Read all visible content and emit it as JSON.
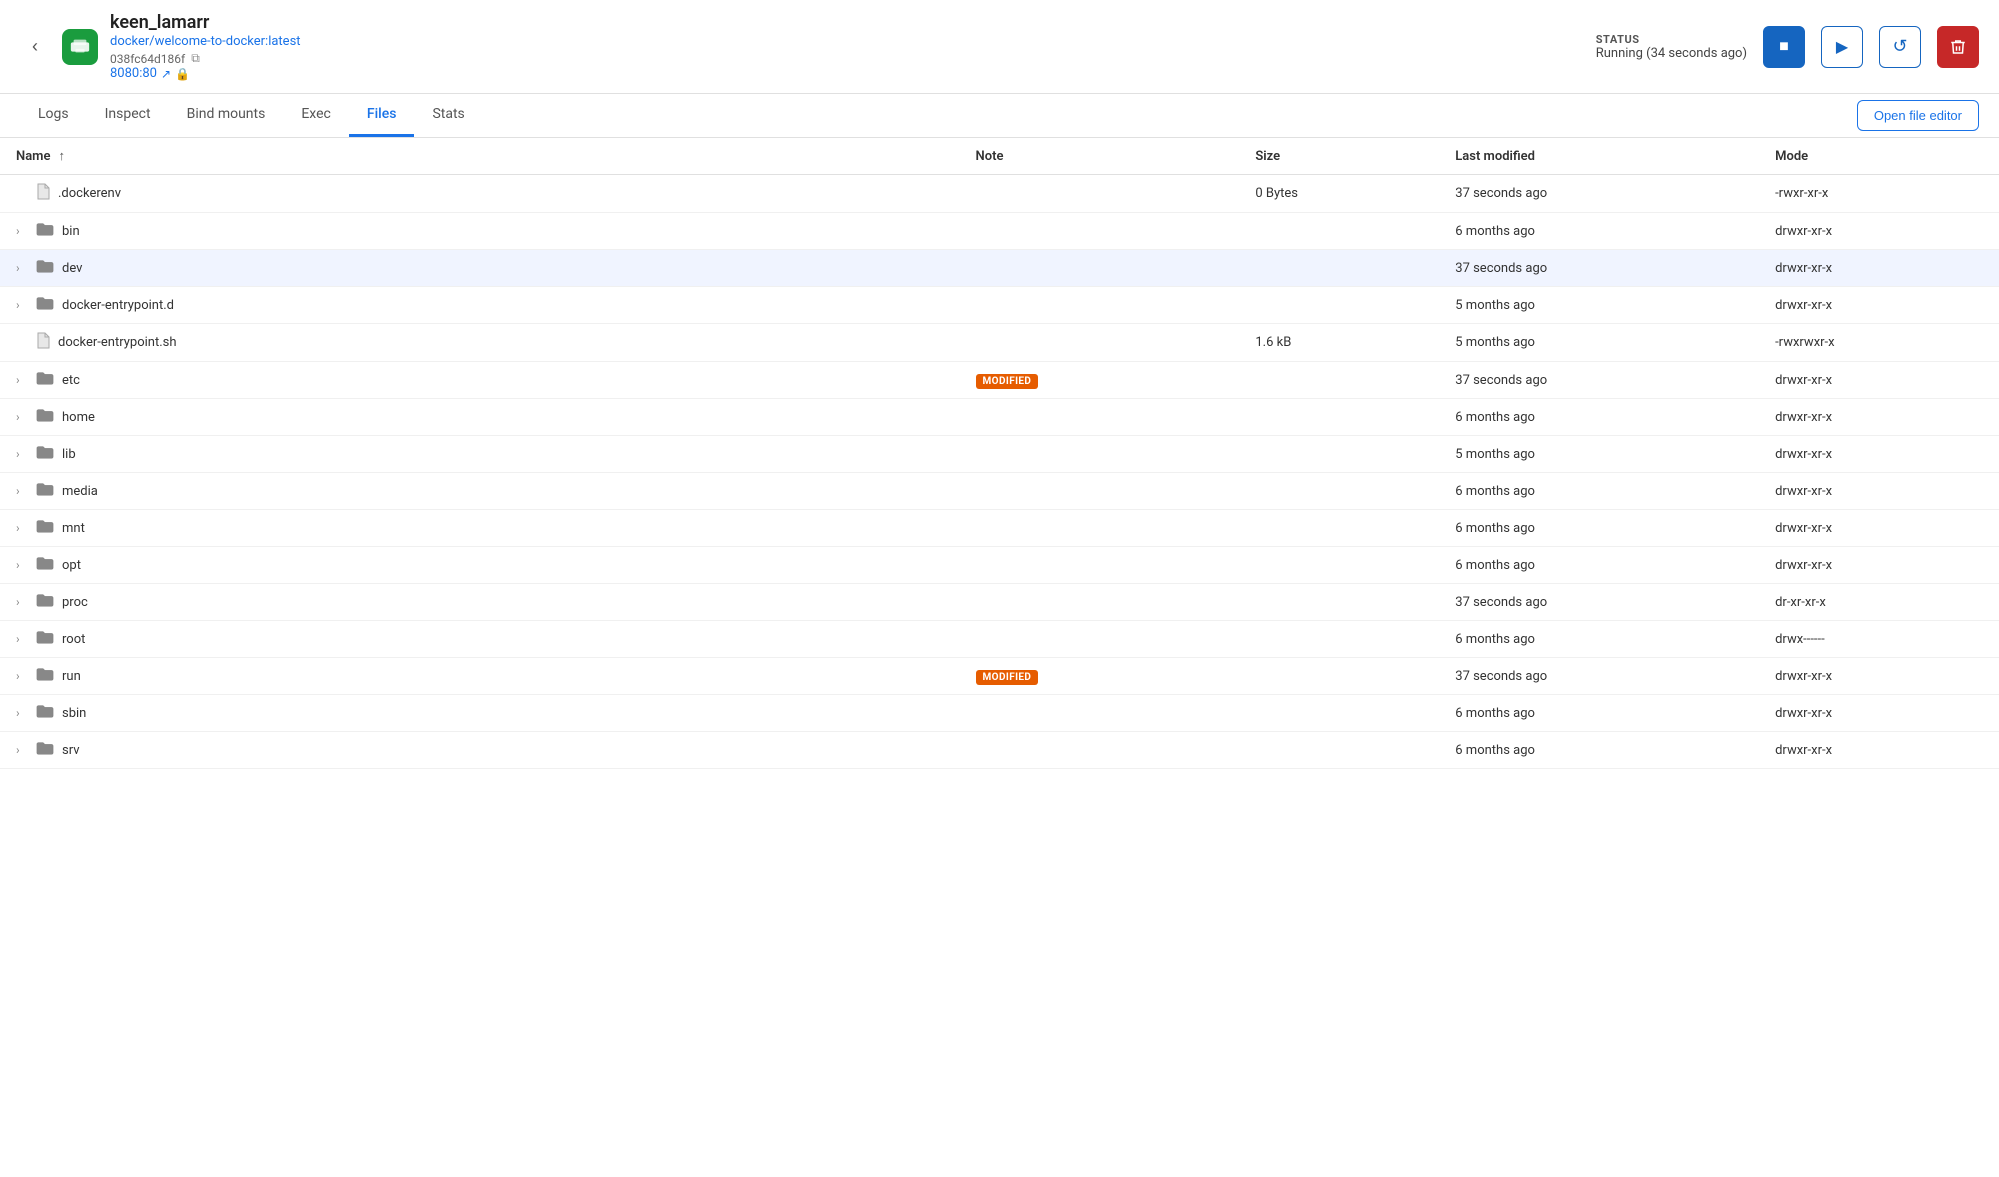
{
  "header": {
    "container_name": "keen_lamarr",
    "image_link": "docker/welcome-to-docker:latest",
    "container_id": "038fc64d186f",
    "port": "8080:80",
    "status_label": "STATUS",
    "status_value": "Running (34 seconds ago)",
    "back_label": "‹"
  },
  "controls": {
    "stop_label": "■",
    "play_label": "▶",
    "restart_label": "↺",
    "delete_label": "🗑"
  },
  "tabs": [
    {
      "id": "logs",
      "label": "Logs",
      "active": false
    },
    {
      "id": "inspect",
      "label": "Inspect",
      "active": false
    },
    {
      "id": "bind-mounts",
      "label": "Bind mounts",
      "active": false
    },
    {
      "id": "exec",
      "label": "Exec",
      "active": false
    },
    {
      "id": "files",
      "label": "Files",
      "active": true
    },
    {
      "id": "stats",
      "label": "Stats",
      "active": false
    }
  ],
  "open_file_editor_label": "Open file editor",
  "table": {
    "columns": [
      {
        "id": "name",
        "label": "Name",
        "sortable": true,
        "sort_dir": "asc"
      },
      {
        "id": "note",
        "label": "Note",
        "sortable": false
      },
      {
        "id": "size",
        "label": "Size",
        "sortable": false
      },
      {
        "id": "modified",
        "label": "Last modified",
        "sortable": false
      },
      {
        "id": "mode",
        "label": "Mode",
        "sortable": false
      }
    ],
    "rows": [
      {
        "name": ".dockerenv",
        "type": "file",
        "note": "",
        "size": "0 Bytes",
        "modified": "37 seconds ago",
        "mode": "-rwxr-xr-x",
        "highlighted": false,
        "expandable": false
      },
      {
        "name": "bin",
        "type": "folder",
        "note": "",
        "size": "",
        "modified": "6 months ago",
        "mode": "drwxr-xr-x",
        "highlighted": false,
        "expandable": true
      },
      {
        "name": "dev",
        "type": "folder",
        "note": "",
        "size": "",
        "modified": "37 seconds ago",
        "mode": "drwxr-xr-x",
        "highlighted": true,
        "expandable": true
      },
      {
        "name": "docker-entrypoint.d",
        "type": "folder",
        "note": "",
        "size": "",
        "modified": "5 months ago",
        "mode": "drwxr-xr-x",
        "highlighted": false,
        "expandable": true
      },
      {
        "name": "docker-entrypoint.sh",
        "type": "file",
        "note": "",
        "size": "1.6 kB",
        "modified": "5 months ago",
        "mode": "-rwxrwxr-x",
        "highlighted": false,
        "expandable": false
      },
      {
        "name": "etc",
        "type": "folder",
        "note": "MODIFIED",
        "size": "",
        "modified": "37 seconds ago",
        "mode": "drwxr-xr-x",
        "highlighted": false,
        "expandable": true
      },
      {
        "name": "home",
        "type": "folder",
        "note": "",
        "size": "",
        "modified": "6 months ago",
        "mode": "drwxr-xr-x",
        "highlighted": false,
        "expandable": true
      },
      {
        "name": "lib",
        "type": "folder",
        "note": "",
        "size": "",
        "modified": "5 months ago",
        "mode": "drwxr-xr-x",
        "highlighted": false,
        "expandable": true
      },
      {
        "name": "media",
        "type": "folder",
        "note": "",
        "size": "",
        "modified": "6 months ago",
        "mode": "drwxr-xr-x",
        "highlighted": false,
        "expandable": true
      },
      {
        "name": "mnt",
        "type": "folder",
        "note": "",
        "size": "",
        "modified": "6 months ago",
        "mode": "drwxr-xr-x",
        "highlighted": false,
        "expandable": true
      },
      {
        "name": "opt",
        "type": "folder",
        "note": "",
        "size": "",
        "modified": "6 months ago",
        "mode": "drwxr-xr-x",
        "highlighted": false,
        "expandable": true
      },
      {
        "name": "proc",
        "type": "folder",
        "note": "",
        "size": "",
        "modified": "37 seconds ago",
        "mode": "dr-xr-xr-x",
        "highlighted": false,
        "expandable": true
      },
      {
        "name": "root",
        "type": "folder",
        "note": "",
        "size": "",
        "modified": "6 months ago",
        "mode": "drwx------",
        "highlighted": false,
        "expandable": true
      },
      {
        "name": "run",
        "type": "folder",
        "note": "MODIFIED",
        "size": "",
        "modified": "37 seconds ago",
        "mode": "drwxr-xr-x",
        "highlighted": false,
        "expandable": true
      },
      {
        "name": "sbin",
        "type": "folder",
        "note": "",
        "size": "",
        "modified": "6 months ago",
        "mode": "drwxr-xr-x",
        "highlighted": false,
        "expandable": true
      },
      {
        "name": "srv",
        "type": "folder",
        "note": "",
        "size": "",
        "modified": "6 months ago",
        "mode": "drwxr-xr-x",
        "highlighted": false,
        "expandable": true
      }
    ]
  }
}
